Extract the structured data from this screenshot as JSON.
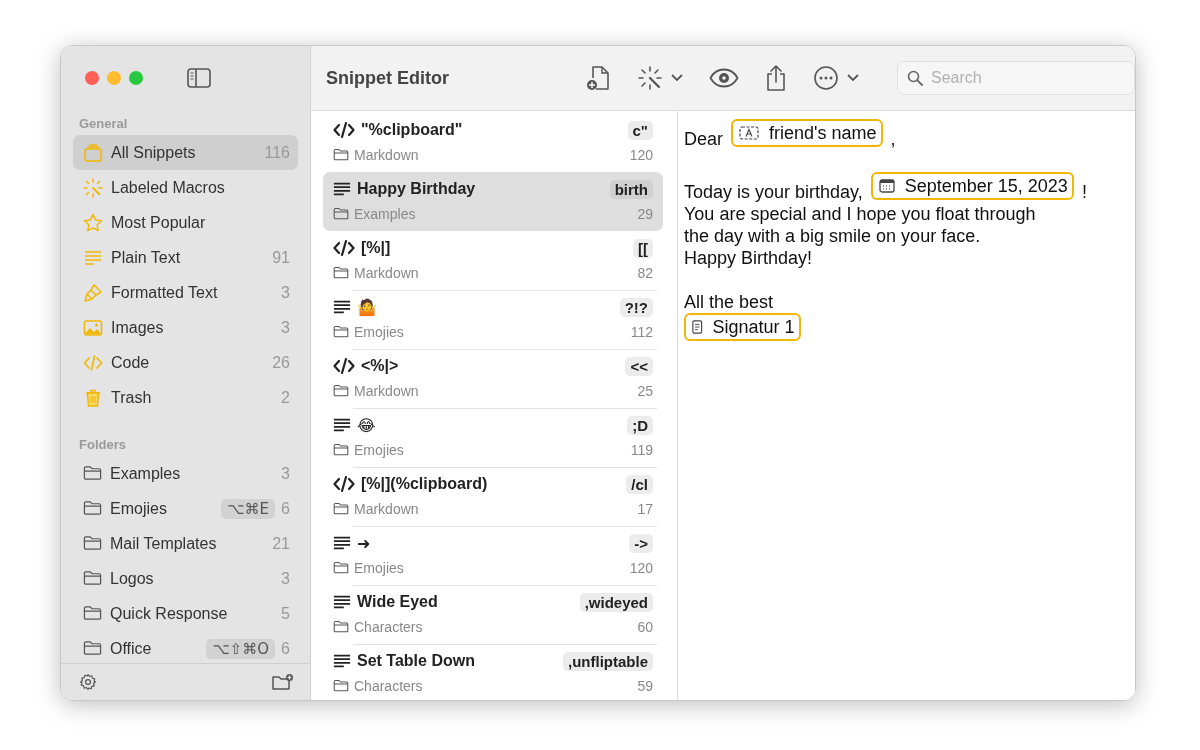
{
  "window": {
    "title": "Snippet Editor"
  },
  "sidebar": {
    "sections": [
      {
        "heading": "General",
        "items": [
          {
            "kind": "all",
            "label": "All Snippets",
            "count": "116",
            "selected": true
          },
          {
            "kind": "macros",
            "label": "Labeled Macros",
            "selected": false
          },
          {
            "kind": "popular",
            "label": "Most Popular",
            "selected": false
          },
          {
            "kind": "plain",
            "label": "Plain Text",
            "count": "91",
            "selected": false
          },
          {
            "kind": "formatted",
            "label": "Formatted Text",
            "count": "3",
            "selected": false
          },
          {
            "kind": "images",
            "label": "Images",
            "count": "3",
            "selected": false
          },
          {
            "kind": "code",
            "label": "Code",
            "count": "26",
            "selected": false
          },
          {
            "kind": "trash",
            "label": "Trash",
            "count": "2",
            "selected": false
          }
        ]
      },
      {
        "heading": "Folders",
        "items": [
          {
            "kind": "folder",
            "label": "Examples",
            "count": "3",
            "selected": false
          },
          {
            "kind": "folder",
            "label": "Emojies",
            "shortcut": "⌥⌘E",
            "count": "6",
            "selected": false
          },
          {
            "kind": "folder",
            "label": "Mail Templates",
            "count": "21",
            "selected": false
          },
          {
            "kind": "folder",
            "label": "Logos",
            "count": "3",
            "selected": false
          },
          {
            "kind": "folder",
            "label": "Quick Response",
            "count": "5",
            "selected": false
          },
          {
            "kind": "folder",
            "label": "Office",
            "shortcut": "⌥⇧⌘O",
            "count": "6",
            "selected": false
          }
        ]
      }
    ]
  },
  "search": {
    "placeholder": "Search"
  },
  "snippets": [
    {
      "kind": "code",
      "title": "\"%clipboard\"",
      "abbreviation": "c\"",
      "folder": "Markdown",
      "count": "120",
      "selected": false
    },
    {
      "kind": "text",
      "title": "Happy Birthday",
      "abbreviation": "birth",
      "folder": "Examples",
      "count": "29",
      "selected": true
    },
    {
      "kind": "code",
      "title": "[%|]",
      "abbreviation": "[[",
      "folder": "Markdown",
      "count": "82",
      "selected": false
    },
    {
      "kind": "text",
      "title": "🤷",
      "abbreviation": "?!?",
      "folder": "Emojies",
      "count": "112",
      "selected": false
    },
    {
      "kind": "code",
      "title": "<%|>",
      "abbreviation": "<<",
      "folder": "Markdown",
      "count": "25",
      "selected": false
    },
    {
      "kind": "text",
      "title": "😂",
      "abbreviation": ";D",
      "folder": "Emojies",
      "count": "119",
      "selected": false
    },
    {
      "kind": "code",
      "title": "[%|](%clipboard)",
      "abbreviation": "/cl",
      "folder": "Markdown",
      "count": "17",
      "selected": false
    },
    {
      "kind": "text",
      "title": "➜",
      "abbreviation": "->",
      "folder": "Emojies",
      "count": "120",
      "selected": false
    },
    {
      "kind": "text",
      "title": "Wide Eyed",
      "abbreviation": ",wideyed",
      "folder": "Characters",
      "count": "60",
      "selected": false
    },
    {
      "kind": "text",
      "title": "Set Table Down",
      "abbreviation": ",unfliptable",
      "folder": "Characters",
      "count": "59",
      "selected": false
    }
  ],
  "editor": {
    "lines": [
      {
        "parts": [
          {
            "kind": "text",
            "text": "Dear"
          },
          {
            "kind": "placeholder",
            "text": "friend's name"
          },
          {
            "kind": "text",
            "text": ","
          }
        ]
      },
      {
        "spaced": true,
        "parts": [
          {
            "kind": "text",
            "text": "Today is your birthday,"
          },
          {
            "kind": "date",
            "text": "September 15, 2023"
          },
          {
            "kind": "text",
            "text": "!"
          }
        ]
      },
      {
        "parts": [
          {
            "kind": "text",
            "text": "You are special and I hope you float through"
          }
        ]
      },
      {
        "parts": [
          {
            "kind": "text",
            "text": "the day with a big smile on your face."
          }
        ]
      },
      {
        "parts": [
          {
            "kind": "text",
            "text": "Happy Birthday!"
          }
        ]
      },
      {
        "spaced": true,
        "parts": [
          {
            "kind": "text",
            "text": "All the best"
          }
        ]
      },
      {
        "parts": [
          {
            "kind": "snippet",
            "text": "Signatur 1"
          }
        ]
      }
    ]
  }
}
